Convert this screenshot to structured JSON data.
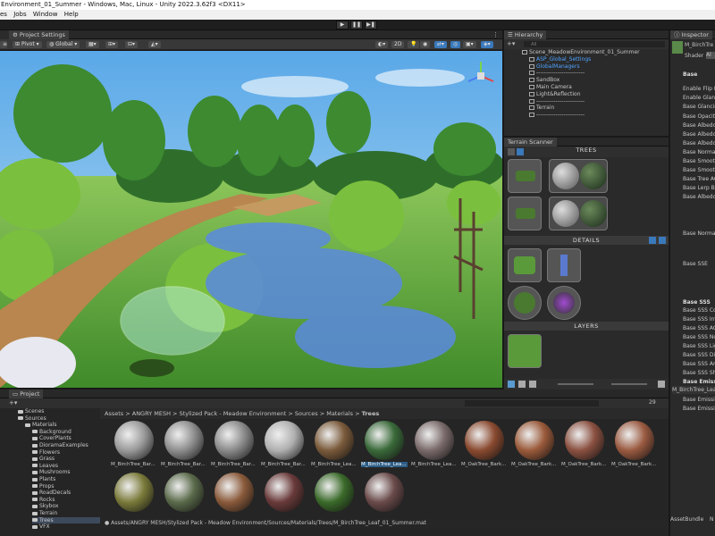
{
  "window": {
    "title": "Environment_01_Summer - Windows, Mac, Linux - Unity 2022.3.62f3 <DX11>"
  },
  "menu": [
    "es",
    "Jobs",
    "Window",
    "Help"
  ],
  "toolbar": {
    "play": "▶",
    "pause": "❚❚",
    "step": "▶❚"
  },
  "scene": {
    "tab_left": "",
    "tab_project_settings": "Project Settings",
    "tools": {
      "pivot": "Pivot",
      "global": "Global",
      "mode_2d": "2D"
    }
  },
  "hierarchy": {
    "tab": "Hierarchy",
    "search_placeholder": "All",
    "items": [
      {
        "label": "Scene_MeadowEnvironment_01_Summer",
        "blue": false
      },
      {
        "label": "ASP_Global_Settings",
        "blue": true
      },
      {
        "label": "GlobalManagers",
        "blue": true
      },
      {
        "label": "-------------------------",
        "blue": false
      },
      {
        "label": "SandBox",
        "blue": false
      },
      {
        "label": "Main Camera",
        "blue": false
      },
      {
        "label": "Light&Reflection",
        "blue": false
      },
      {
        "label": "-------------------------",
        "blue": false
      },
      {
        "label": "Terrain",
        "blue": false
      },
      {
        "label": "-------------------------",
        "blue": false
      }
    ]
  },
  "terrain_scanner": {
    "tab": "Terrain Scanner",
    "trees": "TREES",
    "details": "DETAILS",
    "layers": "LAYERS"
  },
  "inspector": {
    "tab": "Inspector",
    "material_name": "M_BirchTre",
    "shader_label": "Shader",
    "shader_value": "Al",
    "rows": [
      {
        "label": "Base",
        "bold": true
      },
      {
        "label": "Enable Flip N",
        "bold": false
      },
      {
        "label": "Enable Glanci",
        "bold": false
      },
      {
        "label": "Base Glancin",
        "bold": false
      },
      {
        "label": "Base Opacity",
        "bold": false
      },
      {
        "label": "Base Albedo",
        "bold": false
      },
      {
        "label": "Base Albedo",
        "bold": false
      },
      {
        "label": "Base Albedo",
        "bold": false
      },
      {
        "label": "Base Normal",
        "bold": false
      },
      {
        "label": "Base Smooth",
        "bold": false
      },
      {
        "label": "Base Smooth",
        "bold": false
      },
      {
        "label": "Base Tree AC",
        "bold": false
      },
      {
        "label": "Base Lerp Be",
        "bold": false
      },
      {
        "label": "Base Albedo",
        "bold": false
      },
      {
        "label": "Base Normal",
        "bold": false
      },
      {
        "label": "Base SSE",
        "bold": false
      },
      {
        "label": "Base SSS",
        "bold": true
      },
      {
        "label": "Base SSS Co",
        "bold": false
      },
      {
        "label": "Base SSS Int",
        "bold": false
      },
      {
        "label": "Base SSS AO",
        "bold": false
      },
      {
        "label": "Base SSS No",
        "bold": false
      },
      {
        "label": "Base SSS Lig",
        "bold": false
      },
      {
        "label": "Base SSS Dir",
        "bold": false
      },
      {
        "label": "Base SSS Am",
        "bold": false
      },
      {
        "label": "Base SSS Sh",
        "bold": false
      },
      {
        "label": "Base Emissiv",
        "bold": true
      },
      {
        "label": "Base Emissiv",
        "bold": false
      },
      {
        "label": "Base Emissiv",
        "bold": false
      },
      {
        "label": "Base Emissiv",
        "bold": false
      }
    ],
    "footer_name": "M_BirchTree_Lea",
    "asset_bundle": "AssetBundle",
    "asset_bundle_value": "N"
  },
  "project": {
    "tab": "Project",
    "count": "29",
    "breadcrumb": [
      "Assets",
      "ANGRY MESH",
      "Stylized Pack - Meadow Environment",
      "Sources",
      "Materials",
      "Trees"
    ],
    "tree": [
      {
        "label": "Scenes",
        "indent": 2
      },
      {
        "label": "Sources",
        "indent": 2
      },
      {
        "label": "Materials",
        "indent": 3
      },
      {
        "label": "Background",
        "indent": 4
      },
      {
        "label": "CoverPlants",
        "indent": 4
      },
      {
        "label": "DioramaExamples",
        "indent": 4
      },
      {
        "label": "Flowers",
        "indent": 4
      },
      {
        "label": "Grass",
        "indent": 4
      },
      {
        "label": "Leaves",
        "indent": 4
      },
      {
        "label": "Mushrooms",
        "indent": 4
      },
      {
        "label": "Plants",
        "indent": 4
      },
      {
        "label": "Props",
        "indent": 4
      },
      {
        "label": "RoadDecals",
        "indent": 4
      },
      {
        "label": "Rocks",
        "indent": 4
      },
      {
        "label": "Skybox",
        "indent": 4
      },
      {
        "label": "Terrain",
        "indent": 4
      },
      {
        "label": "Trees",
        "indent": 4
      },
      {
        "label": "VFX",
        "indent": 4
      }
    ],
    "assets": [
      {
        "label": "M_BirchTree_Bar...",
        "color": "#9a9a9a"
      },
      {
        "label": "M_BirchTree_Bar...",
        "color": "#8e8e8e"
      },
      {
        "label": "M_BirchTree_Bar...",
        "color": "#8a8a8a"
      },
      {
        "label": "M_BirchTree_Bar...",
        "color": "#b0b0b0"
      },
      {
        "label": "M_BirchTree_Lea...",
        "color": "#7a5a3a"
      },
      {
        "label": "M_BirchTree_Lea...",
        "color": "#3a6a3a"
      },
      {
        "label": "M_BirchTree_Lea...",
        "color": "#7a6a6a"
      },
      {
        "label": "M_OakTree_Bark...",
        "color": "#8a4a30"
      },
      {
        "label": "M_OakTree_Bark...",
        "color": "#9a5a3a"
      },
      {
        "label": "M_OakTree_Bark...",
        "color": "#8a5040"
      },
      {
        "label": "M_OakTree_Bark...",
        "color": "#9a5a40"
      },
      {
        "label": "",
        "color": "#7a7a3a"
      },
      {
        "label": "",
        "color": "#5a6a4a"
      },
      {
        "label": "",
        "color": "#8a5a3a"
      },
      {
        "label": "",
        "color": "#6a3a3a"
      },
      {
        "label": "",
        "color": "#3a6a2a"
      },
      {
        "label": "",
        "color": "#6a4a4a"
      }
    ],
    "status_path": "Assets/ANGRY MESH/Stylized Pack - Meadow Environment/Sources/Materials/Trees/M_BirchTree_Leaf_01_Summer.mat"
  }
}
